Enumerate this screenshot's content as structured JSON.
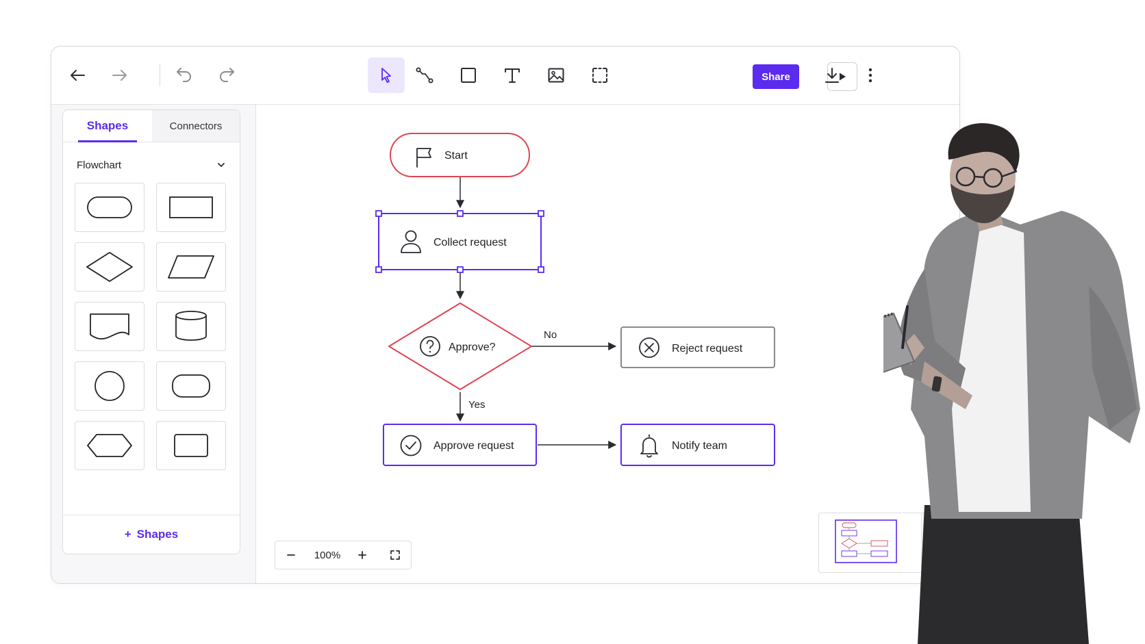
{
  "toolbar": {
    "share_label": "Share",
    "icons": [
      "arrow-left-icon",
      "arrow-right-icon",
      "undo-icon",
      "redo-icon",
      "pointer-icon",
      "connector-icon",
      "rectangle-icon",
      "text-icon",
      "image-icon",
      "frame-select-icon",
      "play-icon",
      "download-icon",
      "more-vertical-icon"
    ],
    "active_tool": "pointer",
    "accent_color": "#5b2bf0"
  },
  "sidebar": {
    "tabs": [
      {
        "label": "Shapes",
        "active": true
      },
      {
        "label": "Connectors",
        "active": false
      }
    ],
    "section_title": "Flowchart",
    "shapes": [
      "terminator",
      "process",
      "decision",
      "data",
      "document",
      "database",
      "circle",
      "rounded-rectangle",
      "preparation",
      "rectangle"
    ],
    "add_shapes_label": "Shapes"
  },
  "flowchart": {
    "nodes": {
      "start": "Start",
      "collect": "Collect request",
      "approve_q": "Approve?",
      "reject": "Reject request",
      "approve": "Approve request",
      "notify": "Notify team"
    },
    "edge_labels": {
      "no": "No",
      "yes": "Yes"
    },
    "colors": {
      "start_decision": "#e0434f",
      "selected": "#5b2bf0",
      "neutral": "#7a7a80"
    }
  },
  "zoom": {
    "level": "100%"
  },
  "minimap": {
    "icon": "sliders-icon"
  }
}
